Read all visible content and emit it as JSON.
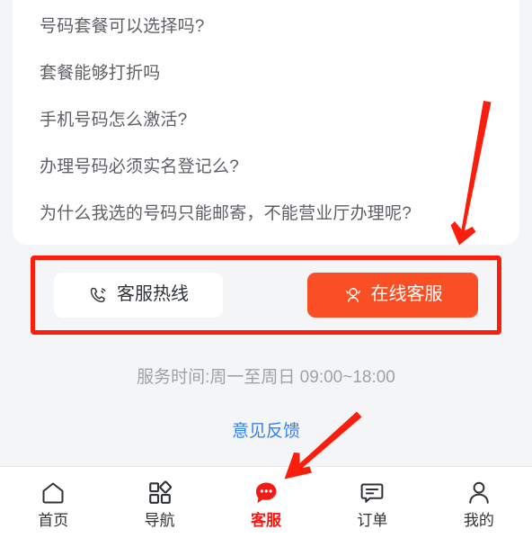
{
  "faq": {
    "items": [
      "号码套餐可以选择吗?",
      "套餐能够打折吗",
      "手机号码怎么激活?",
      "办理号码必须实名登记么?",
      "为什么我选的号码只能邮寄，不能营业厅办理呢?"
    ]
  },
  "actions": {
    "hotline_label": "客服热线",
    "hotline_icon": "phone-call-icon",
    "online_label": "在线客服",
    "online_icon": "headset-agent-icon",
    "online_bg_color": "#fa4f25",
    "annotation_color": "#fa1e0c"
  },
  "service_hours": "服务时间:周一至周日 09:00~18:00",
  "feedback": {
    "label": "意见反馈",
    "color": "#3281f6"
  },
  "tabbar": {
    "active_color": "#f51b14",
    "items": [
      {
        "label": "首页",
        "icon": "home-icon",
        "active": false
      },
      {
        "label": "导航",
        "icon": "grid-nav-icon",
        "active": false
      },
      {
        "label": "客服",
        "icon": "customer-service-bubble-icon",
        "active": true
      },
      {
        "label": "订单",
        "icon": "order-bubble-icon",
        "active": false
      },
      {
        "label": "我的",
        "icon": "user-profile-icon",
        "active": false
      }
    ]
  },
  "annotations": {
    "arrow_color": "#fa1e0c",
    "arrow_1_target": "在线客服",
    "arrow_2_target": "客服"
  }
}
